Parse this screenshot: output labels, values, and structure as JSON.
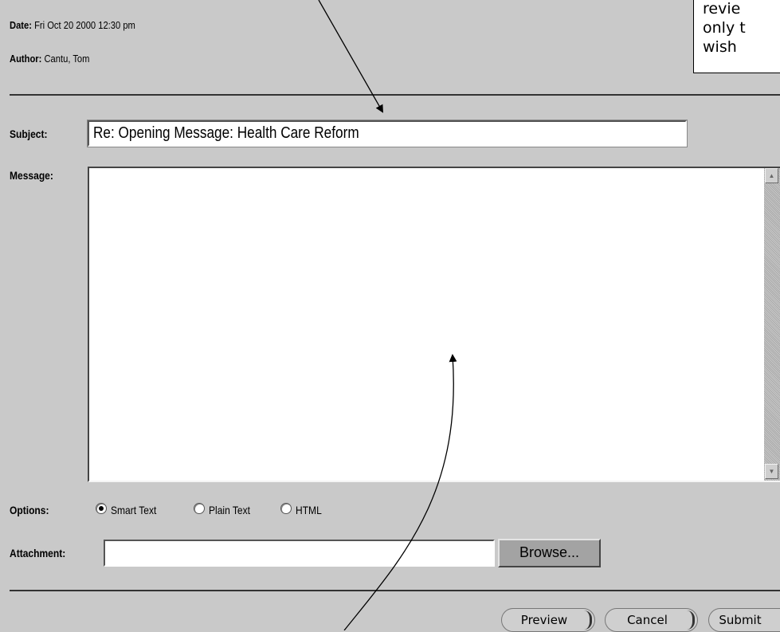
{
  "header": {
    "date_label": "Date:",
    "date_value": "Fri Oct 20 2000 12:30 pm",
    "author_label": "Author:",
    "author_value": "Cantu, Tom"
  },
  "callout": {
    "lines": [
      "revie",
      "only t",
      "wish"
    ]
  },
  "form": {
    "subject_label": "Subject:",
    "subject_value": "Re: Opening Message: Health Care Reform",
    "message_label": "Message:",
    "message_value": "",
    "options_label": "Options:",
    "options": [
      {
        "label": "Smart Text",
        "selected": true
      },
      {
        "label": "Plain Text",
        "selected": false
      },
      {
        "label": "HTML",
        "selected": false
      }
    ],
    "attachment_label": "Attachment:",
    "attachment_value": "",
    "browse_label": "Browse..."
  },
  "actions": {
    "preview_label": "Preview",
    "cancel_label": "Cancel",
    "submit_label": "Submit"
  },
  "colors": {
    "background": "#c9c9c9",
    "field": "#ffffff",
    "browse_button": "#a3a3a3",
    "pill_button": "#cfcfcf"
  },
  "icons": [
    "arrow-annotation",
    "scroll-up-icon",
    "scroll-down-icon",
    "radio-checked-icon",
    "radio-unchecked-icon"
  ]
}
